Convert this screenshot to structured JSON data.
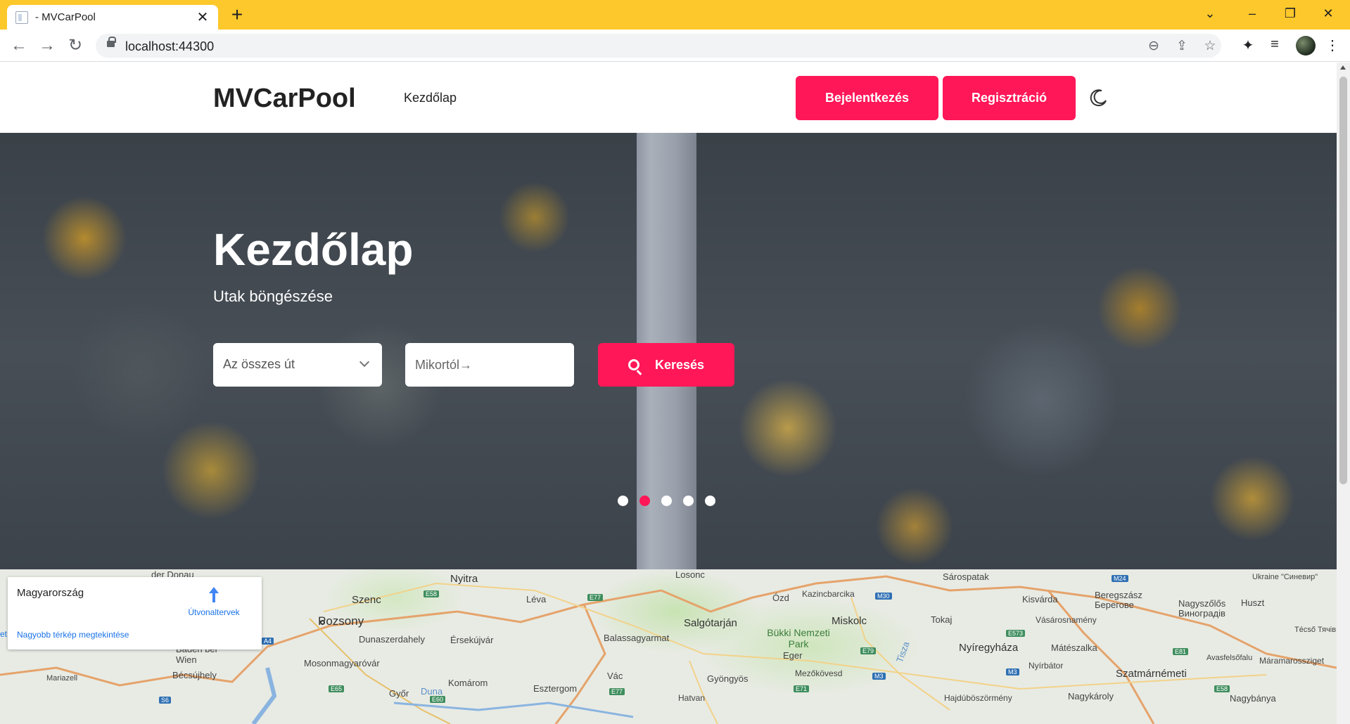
{
  "browser": {
    "tab_title": "- MVCarPool",
    "url": "localhost:44300"
  },
  "header": {
    "brand": "MVCarPool",
    "nav_home": "Kezdőlap",
    "login": "Bejelentkezés",
    "register": "Regisztráció"
  },
  "hero": {
    "title": "Kezdőlap",
    "subtitle": "Utak böngészése",
    "route_select": "Az összes út",
    "date_placeholder": "Mikortól→",
    "search_label": "Keresés",
    "carousel_active_index": 1,
    "carousel_count": 5
  },
  "map": {
    "place_name": "Magyarország",
    "directions_label": "Útvonaltervek",
    "larger_map_link": "Nagyobb térkép megtekintése",
    "labels": {
      "l1": "der Donau",
      "l2": "Nyitra",
      "l3": "Losonc",
      "l4": "Sárospatak",
      "l5": "Szenc",
      "l6": "Léva",
      "l7": "Ózd",
      "l8": "Kazincbarcika",
      "l9": "Kisvárda",
      "l10": "Beregszász Берегове",
      "l11": "Nagyszőlős Виноградів",
      "l12": "Huszt",
      "l13": "Pozsony",
      "l14": "Salgótarján",
      "l15": "Miskolc",
      "l16": "Tokaj",
      "l17": "Vásárosnamény",
      "l18": "Dunaszerdahely",
      "l19": "Érsekújvár",
      "l20": "Balassagyarmat",
      "l21": "Bükki Nemzeti Park",
      "l22": "Nyíregyháza",
      "l23": "Mátészalka",
      "l24": "Baden bei Wien",
      "l25": "Mosonmagyaróvár",
      "l26": "Eger",
      "l27": "Tisza",
      "l28": "Técső Тячів",
      "l29": "Bécsújhely",
      "l30": "Komárom",
      "l31": "Vác",
      "l32": "Gyöngyös",
      "l33": "Mezőkövesd",
      "l34": "Nyírbátor",
      "l35": "Szatmárnémeti",
      "l36": "Avasfelsőfalu",
      "l37": "Máramarossziget",
      "l38": "Mariazell",
      "l39": "Győr",
      "l40": "Duna",
      "l41": "Esztergom",
      "l42": "Hatvan",
      "l43": "Hajdúböszörmény",
      "l44": "Nagykároly",
      "l45": "Nagybánya",
      "l46": "Ukraine \"Синевир\"",
      "l47": "et"
    },
    "roads": {
      "r1": "E58",
      "r2": "E77",
      "r3": "M30",
      "r4": "M24",
      "r5": "A4",
      "r6": "E573",
      "r7": "E79",
      "r8": "M3",
      "r9": "M3",
      "r10": "E81",
      "r11": "E65",
      "r12": "E71",
      "r13": "E58",
      "r14": "E77",
      "r15": "S6",
      "r16": "E60"
    }
  },
  "colors": {
    "accent": "#ff1758",
    "tabbar": "#fdc82b"
  }
}
